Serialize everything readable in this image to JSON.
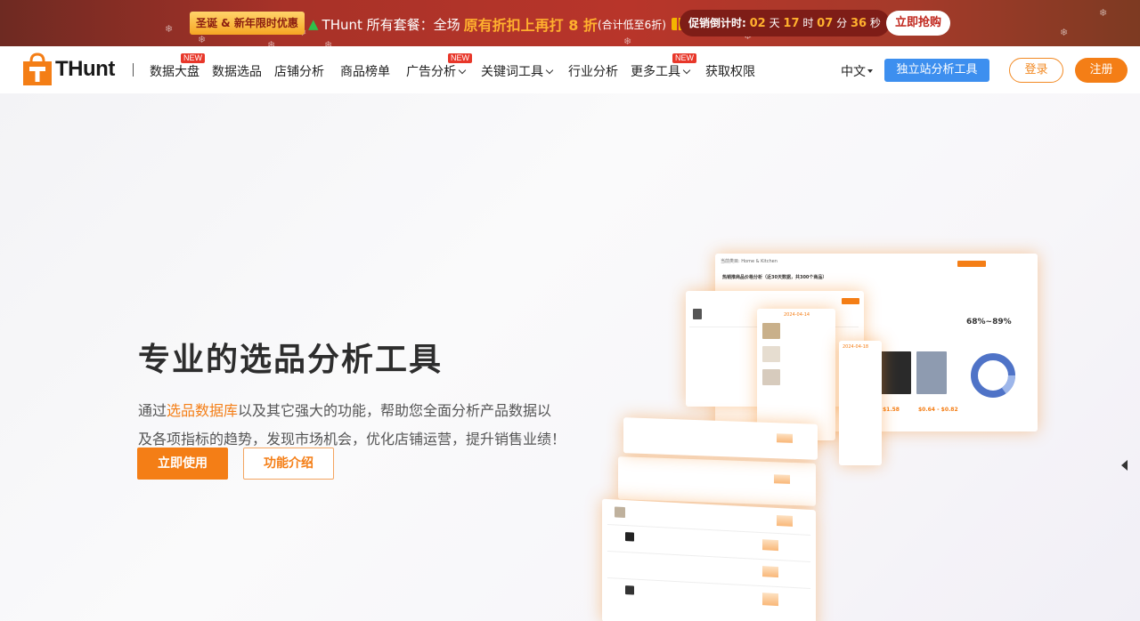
{
  "promo": {
    "tag": "圣诞 & 新年限时优惠",
    "text_prefix": "THunt 所有套餐：全场",
    "highlight": "原有折扣上再打 8 折",
    "note": "(合计低至6折)",
    "countdown_label": "促销倒计时:",
    "days": "02",
    "days_unit": "天",
    "hours": "17",
    "hours_unit": "时",
    "minutes": "07",
    "minutes_unit": "分",
    "seconds": "36",
    "seconds_unit": "秒",
    "buy_label": "立即抢购"
  },
  "nav": {
    "logo_text": "THunt",
    "items": [
      {
        "label": "数据大盘",
        "badge": "NEW"
      },
      {
        "label": "数据选品"
      },
      {
        "label": "店铺分析"
      },
      {
        "label": "商品榜单"
      },
      {
        "label": "广告分析",
        "badge": "NEW"
      },
      {
        "label": "关键词工具"
      },
      {
        "label": "行业分析"
      },
      {
        "label": "更多工具",
        "badge": "NEW"
      },
      {
        "label": "获取权限"
      }
    ],
    "lang": "中文",
    "tool_button": "独立站分析工具",
    "login": "登录",
    "register": "注册"
  },
  "hero": {
    "title": "专业的选品分析工具",
    "desc_prefix": "通过",
    "desc_link": "选品数据库",
    "desc_rest": "以及其它强大的功能，帮助您全面分析产品数据以及各项指标的趋势，发现市场机会，优化店铺运营，提升销售业绩！",
    "primary_button": "立即使用",
    "secondary_button": "功能介绍"
  },
  "illustration": {
    "top_card_title": "热销推商品价格分析（近30天数据，共300个商品）",
    "price_range": "68%~89%",
    "price_a": "$1.58",
    "price_b": "$0.64 - $0.82",
    "date_a": "2024-04-14",
    "date_b": "2024-04-18"
  },
  "colors": {
    "brand_orange": "#f47e16",
    "tool_blue": "#3d8fef",
    "promo_red": "#b8352a",
    "promo_gold": "#ffb02e"
  }
}
